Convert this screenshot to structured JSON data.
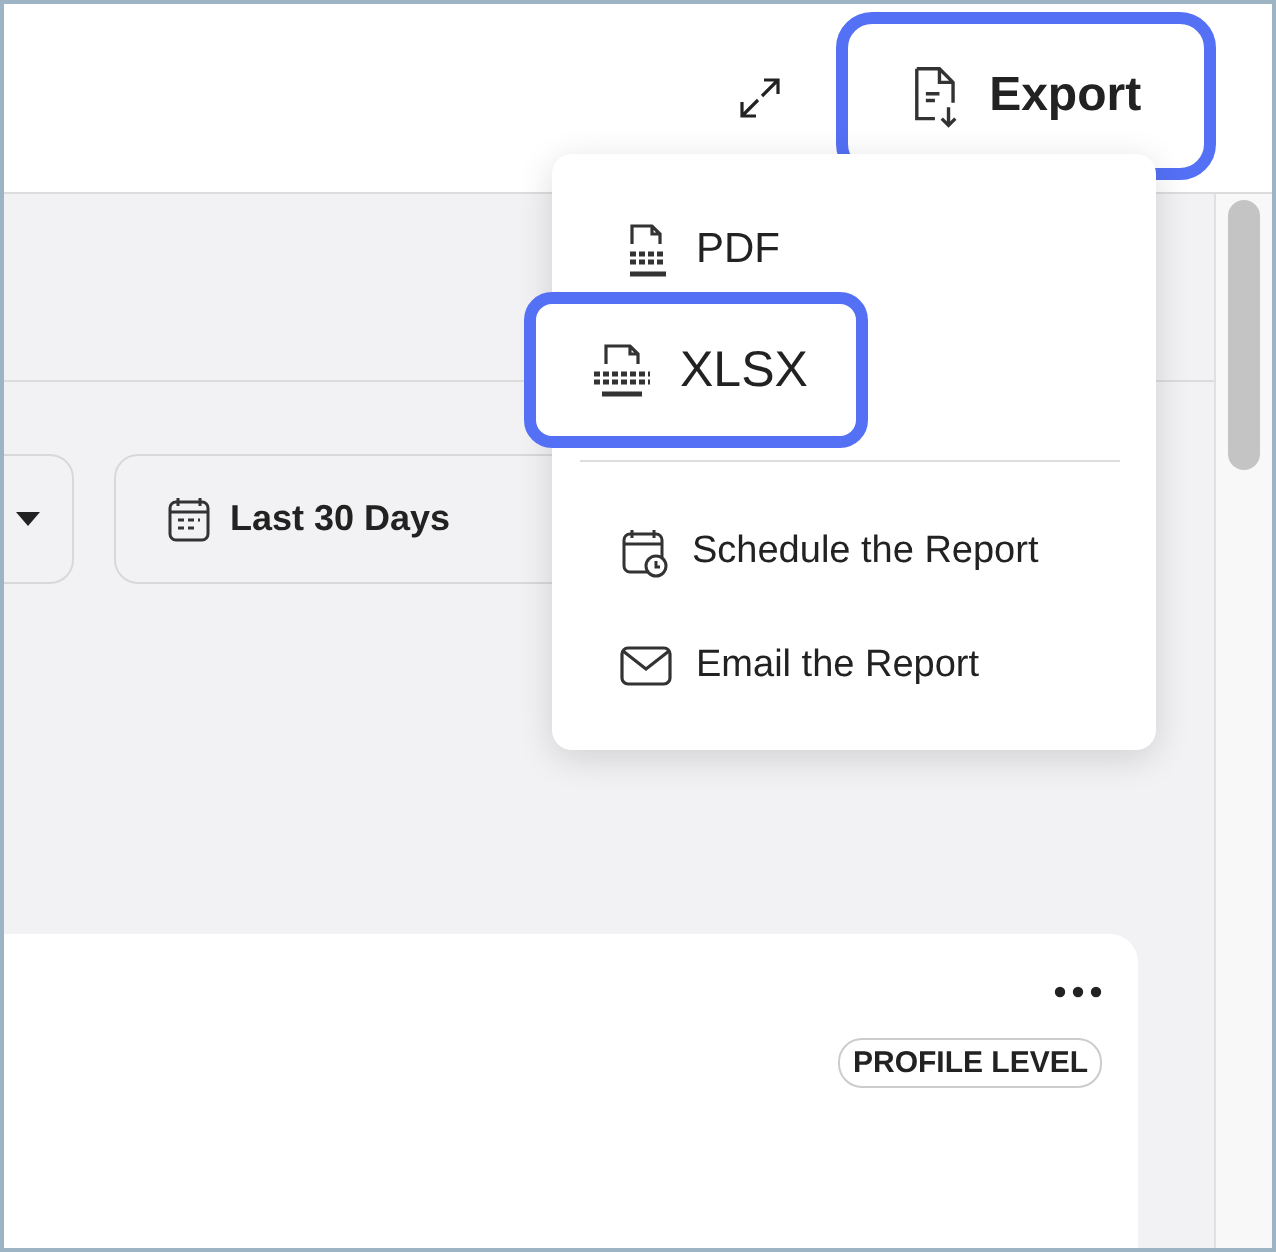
{
  "header": {
    "export_button": {
      "label": "Export",
      "highlighted": true
    }
  },
  "filters": [
    {
      "kind": "dropdown"
    },
    {
      "kind": "date",
      "label": "Last 30 Days"
    }
  ],
  "export_menu": {
    "formats": [
      {
        "label": "PDF",
        "highlighted": false
      },
      {
        "label": "XLSX",
        "highlighted": true
      }
    ],
    "actions": [
      {
        "label": "Schedule the Report"
      },
      {
        "label": "Email the Report"
      }
    ]
  },
  "card": {
    "badge": "PROFILE LEVEL"
  }
}
